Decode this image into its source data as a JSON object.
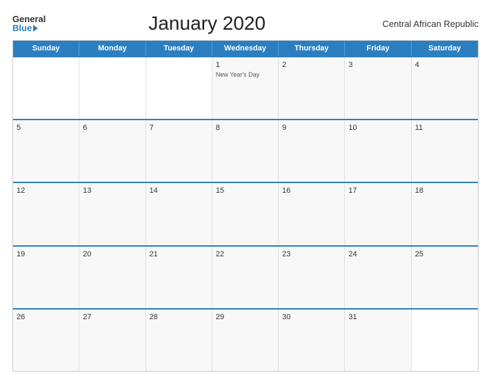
{
  "header": {
    "logo_general": "General",
    "logo_blue": "Blue",
    "title": "January 2020",
    "region": "Central African Republic"
  },
  "calendar": {
    "days_of_week": [
      "Sunday",
      "Monday",
      "Tuesday",
      "Wednesday",
      "Thursday",
      "Friday",
      "Saturday"
    ],
    "weeks": [
      [
        {
          "number": "",
          "holiday": ""
        },
        {
          "number": "",
          "holiday": ""
        },
        {
          "number": "",
          "holiday": ""
        },
        {
          "number": "1",
          "holiday": "New Year's Day"
        },
        {
          "number": "2",
          "holiday": ""
        },
        {
          "number": "3",
          "holiday": ""
        },
        {
          "number": "4",
          "holiday": ""
        }
      ],
      [
        {
          "number": "5",
          "holiday": ""
        },
        {
          "number": "6",
          "holiday": ""
        },
        {
          "number": "7",
          "holiday": ""
        },
        {
          "number": "8",
          "holiday": ""
        },
        {
          "number": "9",
          "holiday": ""
        },
        {
          "number": "10",
          "holiday": ""
        },
        {
          "number": "11",
          "holiday": ""
        }
      ],
      [
        {
          "number": "12",
          "holiday": ""
        },
        {
          "number": "13",
          "holiday": ""
        },
        {
          "number": "14",
          "holiday": ""
        },
        {
          "number": "15",
          "holiday": ""
        },
        {
          "number": "16",
          "holiday": ""
        },
        {
          "number": "17",
          "holiday": ""
        },
        {
          "number": "18",
          "holiday": ""
        }
      ],
      [
        {
          "number": "19",
          "holiday": ""
        },
        {
          "number": "20",
          "holiday": ""
        },
        {
          "number": "21",
          "holiday": ""
        },
        {
          "number": "22",
          "holiday": ""
        },
        {
          "number": "23",
          "holiday": ""
        },
        {
          "number": "24",
          "holiday": ""
        },
        {
          "number": "25",
          "holiday": ""
        }
      ],
      [
        {
          "number": "26",
          "holiday": ""
        },
        {
          "number": "27",
          "holiday": ""
        },
        {
          "number": "28",
          "holiday": ""
        },
        {
          "number": "29",
          "holiday": ""
        },
        {
          "number": "30",
          "holiday": ""
        },
        {
          "number": "31",
          "holiday": ""
        },
        {
          "number": "",
          "holiday": ""
        }
      ]
    ]
  }
}
